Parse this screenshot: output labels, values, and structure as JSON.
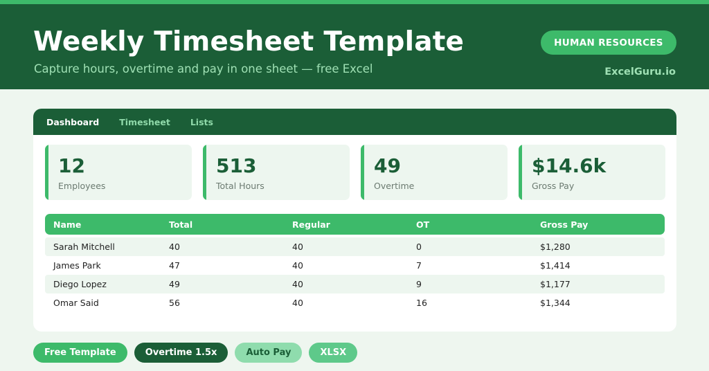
{
  "header": {
    "title": "Weekly Timesheet Template",
    "subtitle": "Capture hours, overtime and pay in one sheet — free Excel",
    "badge": "HUMAN RESOURCES",
    "site": "ExcelGuru.io"
  },
  "tabs": [
    {
      "label": "Dashboard",
      "active": true
    },
    {
      "label": "Timesheet",
      "active": false
    },
    {
      "label": "Lists",
      "active": false
    }
  ],
  "kpis": [
    {
      "value": "12",
      "label": "Employees"
    },
    {
      "value": "513",
      "label": "Total Hours"
    },
    {
      "value": "49",
      "label": "Overtime"
    },
    {
      "value": "$14.6k",
      "label": "Gross Pay"
    }
  ],
  "table": {
    "headers": [
      "Name",
      "Total",
      "Regular",
      "OT",
      "Gross Pay"
    ],
    "rows": [
      [
        "Sarah Mitchell",
        "40",
        "40",
        "0",
        "$1,280"
      ],
      [
        "James Park",
        "47",
        "40",
        "7",
        "$1,414"
      ],
      [
        "Diego Lopez",
        "49",
        "40",
        "9",
        "$1,177"
      ],
      [
        "Omar Said",
        "56",
        "40",
        "16",
        "$1,344"
      ]
    ]
  },
  "tags": [
    "Free Template",
    "Overtime 1.5x",
    "Auto Pay",
    "XLSX"
  ],
  "colors": {
    "dark_green": "#1b5e37",
    "accent_green": "#3dba6a",
    "light_green": "#9fe0b4",
    "background": "#eef6ef"
  }
}
